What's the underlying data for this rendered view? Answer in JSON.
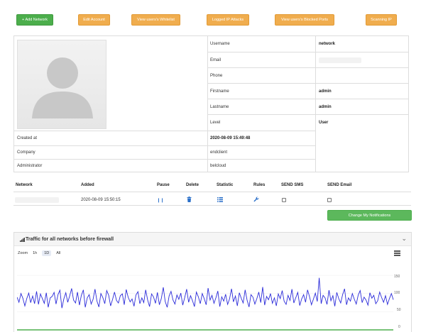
{
  "toolbar": {
    "add_network": "+ Add Network",
    "edit_account": "Edit Account",
    "whitelist": "View users's Whitelist",
    "logged_ip": "Logged IP Attacks",
    "blocked_ports": "View users's Blocked Ports",
    "scanning_ip": "Scanning IP"
  },
  "profile": {
    "rows": [
      {
        "label": "Username",
        "value": "network"
      },
      {
        "label": "Email",
        "value": ""
      },
      {
        "label": "Phone",
        "value": ""
      },
      {
        "label": "Firstname",
        "value": "admin"
      },
      {
        "label": "Lastname",
        "value": "admin"
      },
      {
        "label": "Level",
        "value": "User"
      }
    ],
    "created_label": "Created at",
    "created_value": "2020-08-09 15:49:48",
    "company_label": "Company",
    "company_value": "endclient",
    "admin_label": "Administrator",
    "admin_value": "belcloud"
  },
  "networks": {
    "headers": [
      "Network",
      "Added",
      "Pause",
      "Delete",
      "Statistic",
      "Rules",
      "SEND SMS",
      "SEND Email"
    ],
    "row": {
      "added": "2020-08-09 15:50:15"
    },
    "notify_button": "Change My Notifications"
  },
  "traffic": {
    "title": "Traffic for all networks before firewall",
    "zoom_label": "Zoom",
    "zoom_options": [
      "1h",
      "1D",
      "All"
    ],
    "zoom_active": "1D"
  },
  "colors": {
    "line": "#2b2bd9",
    "green": "#4cae4c",
    "orange": "#f0ad4e"
  },
  "chart_data": {
    "type": "line",
    "yticks": [
      0,
      50,
      100,
      150
    ],
    "ylim": [
      0,
      160
    ],
    "series": [
      {
        "values": [
          90,
          76,
          100,
          87,
          66,
          86,
          101,
          75,
          93,
          72,
          106,
          70,
          99,
          86,
          73,
          102,
          62,
          88,
          92,
          103,
          71,
          97,
          109,
          60,
          85,
          102,
          76,
          93,
          114,
          82,
          74,
          104,
          68,
          95,
          110,
          62,
          88,
          97,
          71,
          84,
          112,
          79,
          63,
          100,
          89,
          72,
          108,
          95,
          66,
          84,
          104,
          81,
          74,
          94,
          99,
          69,
          111,
          90,
          77,
          85,
          65,
          96,
          105,
          72,
          88,
          75,
          110,
          82,
          64,
          99,
          91,
          73,
          103,
          69,
          86,
          117,
          78,
          62,
          93,
          106,
          82,
          71,
          96,
          84,
          101,
          68,
          89,
          112,
          76,
          94,
          80,
          64,
          104,
          91,
          72,
          100,
          86,
          69,
          115,
          82,
          95,
          73,
          88,
          107,
          64,
          91,
          79,
          98,
          70,
          85,
          113,
          77,
          93,
          66,
          102,
          87,
          74,
          110,
          82,
          63,
          97,
          90,
          71,
          86,
          104,
          75,
          118,
          68,
          92,
          83,
          100,
          73,
          88,
          66,
          99,
          86,
          108,
          79,
          70,
          95,
          81,
          112,
          74,
          89,
          103,
          67,
          85,
          97,
          76,
          110,
          92,
          69,
          84,
          101,
          78,
          143,
          72,
          95,
          88,
          70,
          109,
          80,
          94,
          65,
          103,
          86,
          74,
          97,
          113,
          69,
          88,
          79,
          100,
          84,
          71,
          96,
          108,
          75,
          90,
          82,
          68,
          102,
          87,
          95,
          72,
          80,
          104,
          89,
          76,
          94,
          70,
          86,
          100,
          83
        ]
      }
    ]
  }
}
